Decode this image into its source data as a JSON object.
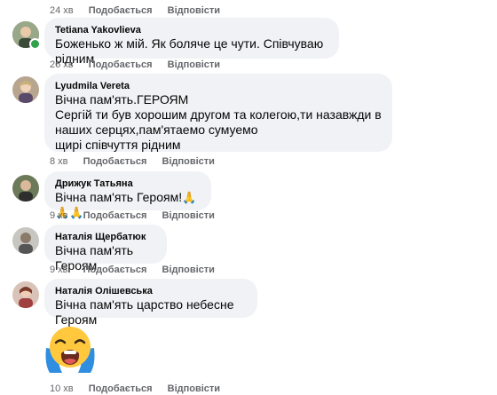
{
  "comments": [
    {
      "author": "",
      "text": "",
      "time": "24 хв",
      "like": "Подобається",
      "reply": "Відповісти"
    },
    {
      "author": "Tetiana Yakovlieva",
      "text": "Боженько ж мій. Як боляче це чути. Співчуваю рідним",
      "time": "26 хв",
      "like": "Подобається",
      "reply": "Відповісти"
    },
    {
      "author": "Lyudmila Vereta",
      "text": "Вічна пам'ять.ГЕРОЯМ\nСергій ти був хорошим другом та колегою,ти назавжди в наших серцях,пам'ятаемо сумуемо\nщирі співчуття рідним",
      "time": "8 хв",
      "like": "Подобається",
      "reply": "Відповісти"
    },
    {
      "author": "Дрижук Татьяна",
      "text": "Вічна пам'ять Героям!",
      "emoji": "🙏🙏🙏",
      "time": "9 хв",
      "like": "Подобається",
      "reply": "Відповісти"
    },
    {
      "author": "Наталія Щербатюк",
      "text": "Вічна пам'ять Героям",
      "time": "9 хв",
      "like": "Подобається",
      "reply": "Відповісти"
    },
    {
      "author": "Наталія Олішевська",
      "text": "Вічна пам'ять царство небесне Героям",
      "time": "10 хв",
      "like": "Подобається",
      "reply": "Відповісти"
    }
  ],
  "colors": {
    "bubble": "#f0f2f5",
    "meta": "#65676b",
    "online": "#31a24c"
  },
  "icons": {
    "sticker": "loudly-crying-face-sticker"
  }
}
